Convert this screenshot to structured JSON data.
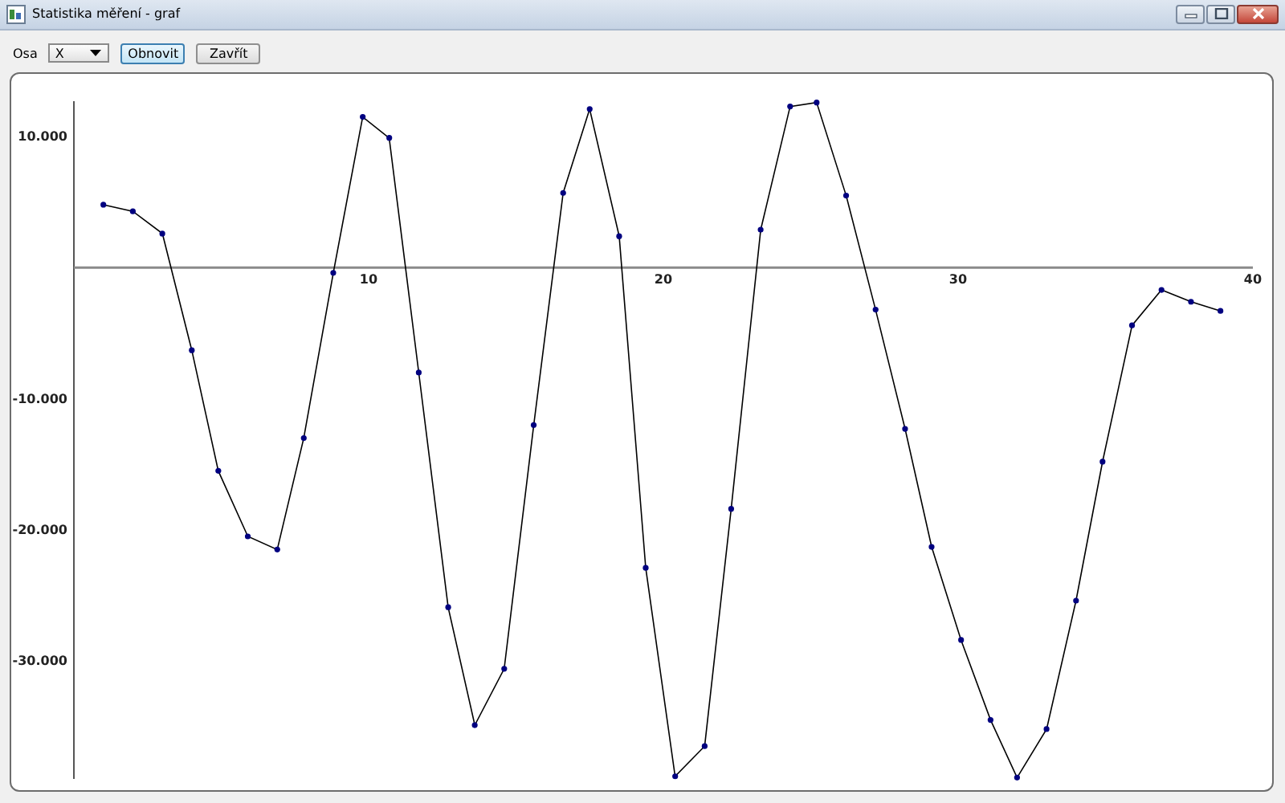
{
  "window": {
    "title": "Statistika měření - graf"
  },
  "toolbar": {
    "axis_label": "Osa",
    "axis_select": {
      "value": "X"
    },
    "buttons": [
      {
        "label": "Obnovit",
        "focused": true
      },
      {
        "label": "Zavřít",
        "focused": false
      }
    ]
  },
  "chart": {
    "chart_data": {
      "type": "line",
      "xlim": [
        0,
        40
      ],
      "ylim": [
        -39000,
        12700
      ],
      "xticks": [
        10,
        20,
        30,
        40
      ],
      "yticks": [
        {
          "value": 10000,
          "label": "10.000"
        },
        {
          "value": -10000,
          "label": "-10.000"
        },
        {
          "value": -20000,
          "label": "-20.000"
        },
        {
          "value": -30000,
          "label": "-30.000"
        }
      ],
      "x": [
        1.0,
        2.0,
        3.0,
        4.0,
        4.9,
        5.9,
        6.9,
        7.8,
        8.8,
        9.8,
        10.7,
        11.7,
        12.7,
        13.6,
        14.6,
        15.6,
        16.6,
        17.5,
        18.5,
        19.4,
        20.4,
        21.4,
        22.3,
        23.3,
        24.3,
        25.2,
        26.2,
        27.2,
        28.2,
        29.1,
        30.1,
        31.1,
        32.0,
        33.0,
        34.0,
        34.9,
        35.9,
        36.9,
        37.9,
        38.9
      ],
      "series": [
        {
          "color": "#000080",
          "marker": "circle",
          "values": [
            4800,
            4300,
            2600,
            -6300,
            -15500,
            -20500,
            -21500,
            -13000,
            -400,
            11500,
            9900,
            -8000,
            -25900,
            -34900,
            -30600,
            -12000,
            5700,
            12100,
            2400,
            -22900,
            -38800,
            -36500,
            -18400,
            2900,
            12300,
            12600,
            5500,
            -3200,
            -12300,
            -21300,
            -28400,
            -34500,
            -38900,
            -35200,
            -25400,
            -14800,
            -4400,
            -1700,
            -2600,
            -3300
          ]
        }
      ]
    }
  }
}
